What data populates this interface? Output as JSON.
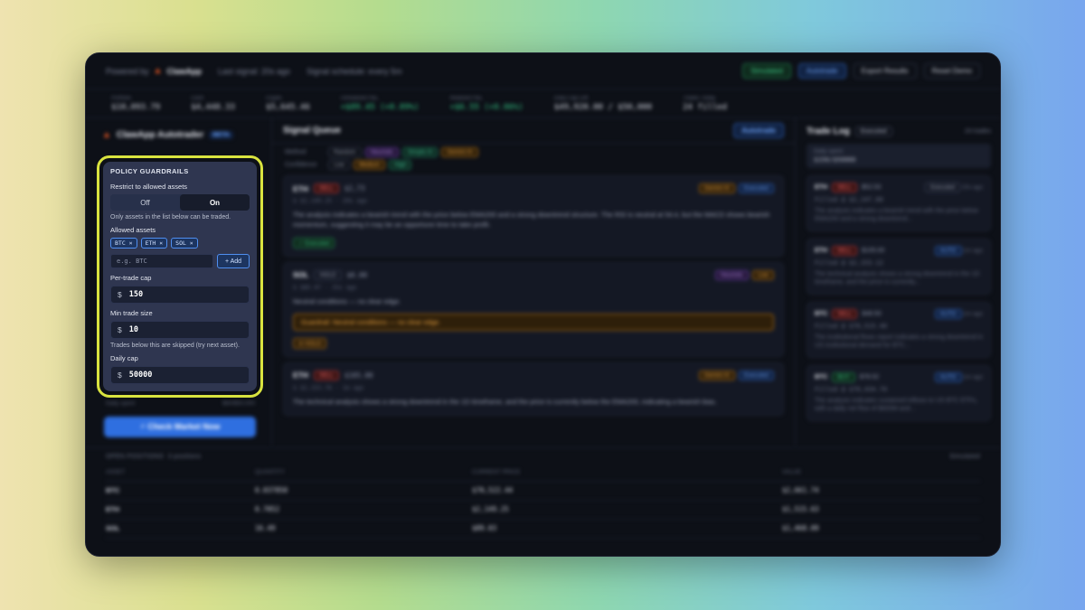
{
  "topbar": {
    "powered_by": "Powered by",
    "brand": "ClawApp",
    "last_signal": "Last signal: 20s ago",
    "schedule": "Signal schedule: every 5m",
    "simulated": "Simulated",
    "autotrade": "Autotrade",
    "export": "Export Results",
    "reset": "Reset Demo"
  },
  "stats": [
    {
      "label": "Portfolio",
      "value": "$10,093.79",
      "positive": false
    },
    {
      "label": "Cash",
      "value": "$4,448.33",
      "positive": false
    },
    {
      "label": "Crypto",
      "value": "$5,645.46",
      "positive": false
    },
    {
      "label": "Unrealized P&L",
      "value": "+$89.45 (+0.89%)",
      "positive": true
    },
    {
      "label": "Realized P&L",
      "value": "+$6.55 (+0.06%)",
      "positive": true
    },
    {
      "label": "Daily Cap Left",
      "value": "$49,920.00 / $50,000",
      "positive": false
    },
    {
      "label": "Trades Today",
      "value": "24 filled",
      "positive": false
    }
  ],
  "left": {
    "app_name": "ClawApp Autotrader",
    "beta": "BETA",
    "guardrails": {
      "title": "POLICY GUARDRAILS",
      "restrict_label": "Restrict to allowed assets",
      "toggle_off": "Off",
      "toggle_on": "On",
      "restrict_hint": "Only assets in the list below can be traded.",
      "allowed_label": "Allowed assets",
      "assets": [
        "BTC ×",
        "ETH ×",
        "SOL ×"
      ],
      "add_placeholder": "e.g. BTC",
      "add_button": "+ Add",
      "per_trade_label": "Per-trade cap",
      "currency": "$",
      "per_trade_value": "150",
      "min_trade_label": "Min trade size",
      "min_trade_value": "10",
      "min_trade_hint": "Trades below this are skipped (try next asset).",
      "daily_cap_label": "Daily cap",
      "daily_cap_value": "50000"
    },
    "below_left": "Daily spent",
    "below_right": "$80/$50,000",
    "cta": "⚡ Check Market Now"
  },
  "queue": {
    "title": "Signal Queue",
    "badge": "Autotrade",
    "method_label": "Method",
    "methods": [
      "Random",
      "Heuristic",
      "Simple AI",
      "Gemini AI"
    ],
    "confidence_label": "Confidence",
    "confidences": [
      "Low",
      "Medium",
      "High"
    ],
    "cards": [
      {
        "symbol": "ETH",
        "side": "SELL",
        "price": "$2,73",
        "tags": [
          "Gemini AI",
          "Executed"
        ],
        "sub": "$ $2,149.25 · 20s ago",
        "body": "The analysis indicates a bearish trend with the price below EMA200 and a strong downtrend structure. The RSI is neutral at 54.4, but the MACD shows bearish momentum, suggesting it may be an opportune time to take profit.",
        "action": "✓ Executed",
        "warning": ""
      },
      {
        "symbol": "SOL",
        "side": "HOLD",
        "price": "$0.00",
        "tags": [
          "Heuristic",
          "Low"
        ],
        "sub": "$ $85.07 · 25s ago",
        "body": "Neutral conditions — no clear edge.",
        "action": "⊘ HOLD",
        "warning": "Guardrail: Neutral conditions — no clear edge."
      },
      {
        "symbol": "ETH",
        "side": "SELL",
        "price": "$105.00",
        "tags": [
          "Gemini AI",
          "Executed"
        ],
        "sub": "$ $2,153.76 · 1m ago",
        "body": "The technical analysis shows a strong downtrend in the 1D timeframe, and the price is currently below the EMA200, indicating a bearish bias.",
        "action": "",
        "warning": ""
      }
    ]
  },
  "log": {
    "title": "Trade Log",
    "badge": "Executed",
    "count": "24 trades",
    "daily_label": "Daily spent",
    "daily_value": "$150/$50000",
    "items": [
      {
        "symbol": "ETH",
        "side": "SELL",
        "amount": "$52.53",
        "tag": "Executed",
        "time": "20s ago",
        "fill": "Filled @ $2,147.00",
        "desc": "The analysis indicates a bearish trend with the price below EMA200 and a strong downtrend..."
      },
      {
        "symbol": "ETH",
        "side": "SELL",
        "amount": "$105.00",
        "tag": "AUTO",
        "time": "1m ago",
        "fill": "Filled @ $2,153.12",
        "desc": "The technical analysis shows a strong downtrend in the 1D timeframe, and the price is currently..."
      },
      {
        "symbol": "BTC",
        "side": "SELL",
        "amount": "$48.50",
        "tag": "AUTO",
        "time": "1m ago",
        "fill": "Filled @ $70,515.40",
        "desc": "The institutional flows report indicates a strong downtrend in US institutional demand for BTC..."
      },
      {
        "symbol": "BTC",
        "side": "BUY",
        "amount": "$78.52",
        "tag": "AUTO",
        "time": "1m ago",
        "fill": "Filled @ $70,434.70",
        "desc": "The analysis indicates sustained inflows to US BTC ETFs, with a daily net flow of $600M and..."
      }
    ]
  },
  "positions": {
    "title": "OPEN POSITIONS",
    "count": "3 positions",
    "right": "Simulated",
    "columns": [
      "ASSET",
      "QUANTITY",
      "CURRENT PRICE",
      "VALUE"
    ],
    "rows": [
      [
        "BTC",
        "0.037850",
        "$70,522.44",
        "$2,661.74"
      ],
      [
        "ETH",
        "0.7052",
        "$2,149.25",
        "$1,515.63"
      ],
      [
        "SOL",
        "16.49",
        "$89.03",
        "$1,468.09"
      ]
    ]
  }
}
